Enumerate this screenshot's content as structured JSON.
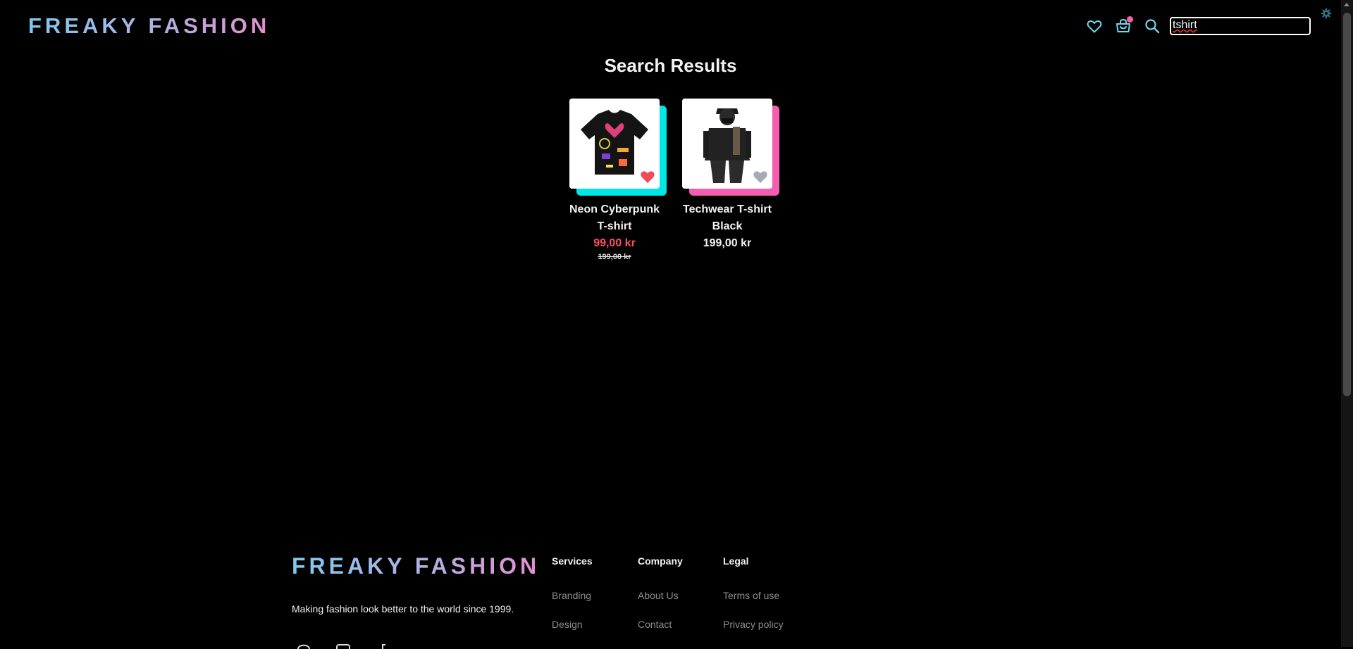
{
  "header": {
    "logo": "FREAKY FASHION",
    "search_value": "tshirt"
  },
  "main": {
    "title": "Search Results",
    "products": [
      {
        "name_line1": "Neon Cyberpunk",
        "name_line2": "T-shirt",
        "price": "99,00 kr",
        "old_price": "199,00 kr",
        "favorited": true
      },
      {
        "name_line1": "Techwear T-shirt",
        "name_line2": "Black",
        "price": "199,00 kr",
        "favorited": false
      }
    ]
  },
  "footer": {
    "logo": "FREAKY FASHION",
    "tagline": "Making fashion look better to the world since 1999.",
    "columns": [
      {
        "heading": "Services",
        "links": [
          "Branding",
          "Design"
        ]
      },
      {
        "heading": "Company",
        "links": [
          "About Us",
          "Contact"
        ]
      },
      {
        "heading": "Legal",
        "links": [
          "Terms of use",
          "Privacy policy"
        ]
      }
    ]
  },
  "colors": {
    "background": "#000000",
    "icon_accent": "#6fd8ee",
    "sale_price": "#ff4d5e",
    "glow_cyan": "#00e5e5",
    "glow_pink": "#f25fb0",
    "cart_badge": "#ff5fa2"
  },
  "icons": [
    "heart-icon",
    "cart-icon",
    "search-icon",
    "gear-icon"
  ]
}
